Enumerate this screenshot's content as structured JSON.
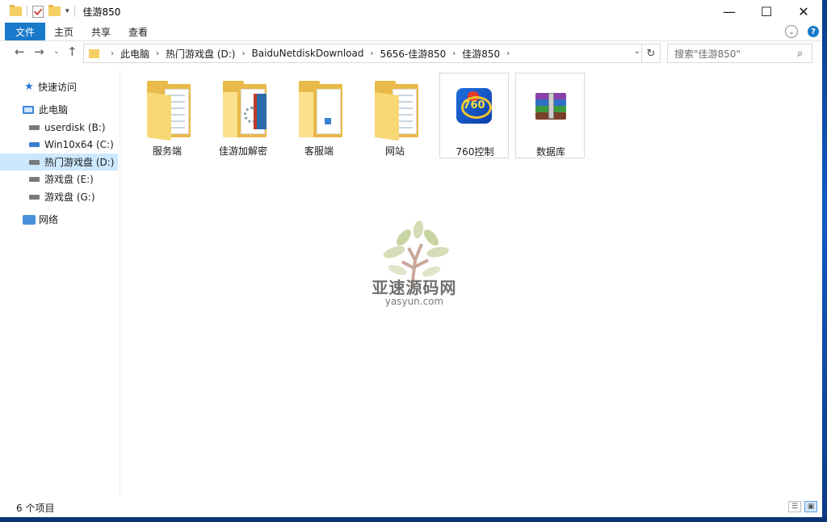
{
  "window": {
    "title": "佳游850",
    "caption": {
      "minimize": "—",
      "maximize": "☐",
      "close": "✕"
    }
  },
  "ribbon": {
    "file": "文件",
    "tabs": [
      "主页",
      "共享",
      "查看"
    ]
  },
  "address": {
    "breadcrumbs": [
      "此电脑",
      "热门游戏盘 (D:)",
      "BaiduNetdiskDownload",
      "5656-佳游850",
      "佳游850"
    ]
  },
  "search": {
    "placeholder": "搜索\"佳游850\""
  },
  "sidebar": {
    "items": [
      {
        "label": "快速访问",
        "icon": "star-icon"
      },
      {
        "label": "此电脑",
        "icon": "computer-icon"
      },
      {
        "label": "userdisk (B:)",
        "icon": "drive-icon"
      },
      {
        "label": "Win10x64 (C:)",
        "icon": "windows-drive-icon"
      },
      {
        "label": "热门游戏盘 (D:)",
        "icon": "drive-icon",
        "selected": true
      },
      {
        "label": "游戏盘 (E:)",
        "icon": "drive-icon"
      },
      {
        "label": "游戏盘 (G:)",
        "icon": "drive-icon"
      },
      {
        "label": "网络",
        "icon": "network-icon"
      }
    ]
  },
  "files": [
    {
      "name": "服务端",
      "type": "folder"
    },
    {
      "name": "佳游加解密",
      "type": "folder"
    },
    {
      "name": "客服端",
      "type": "folder"
    },
    {
      "name": "网站",
      "type": "folder"
    },
    {
      "name": "760控制",
      "type": "application"
    },
    {
      "name": "数据库",
      "type": "rar-archive"
    }
  ],
  "watermark": {
    "name": "亚速源码网",
    "url": "yasyun.com"
  },
  "status": {
    "count": "6 个项目"
  },
  "colors": {
    "accent": "#1979ca",
    "selection": "#cce8ff",
    "folder": "#f8d775"
  }
}
